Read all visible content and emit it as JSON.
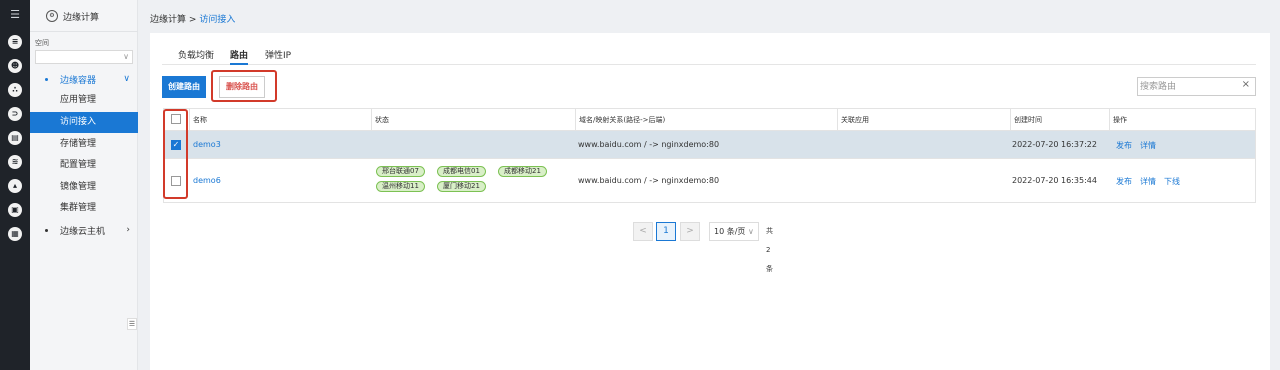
{
  "app": {
    "name": "边缘计算"
  },
  "rail_icons": [
    "menu-icon",
    "storage-icon",
    "robot-icon",
    "network-icon",
    "edge-icon",
    "database-icon",
    "layers-icon",
    "cloud-icon",
    "box-icon",
    "device-icon"
  ],
  "sidebar": {
    "space_label": "空间",
    "space_value": "",
    "groups": [
      {
        "label": "边缘容器",
        "expanded": true,
        "items": [
          "应用管理",
          "访问接入",
          "存储管理",
          "配置管理",
          "镜像管理",
          "集群管理"
        ]
      },
      {
        "label": "边缘云主机",
        "expanded": false
      }
    ],
    "active_item": "访问接入"
  },
  "breadcrumb": {
    "root": "边缘计算",
    "sep": ">",
    "current": "访问接入"
  },
  "tabs": [
    "负载均衡",
    "路由",
    "弹性IP"
  ],
  "active_tab": "路由",
  "toolbar": {
    "create_label": "创建路由",
    "delete_label": "删除路由"
  },
  "search": {
    "placeholder": "搜索路由",
    "clear": "×"
  },
  "table": {
    "headers": [
      "名称",
      "状态",
      "域名/映射关系(路径->后端)",
      "关联应用",
      "创建时间",
      "操作"
    ],
    "rows": [
      {
        "checked": true,
        "name": "demo3",
        "tags": [],
        "mapping": "www.baidu.com   / -> nginxdemo:80",
        "app": "",
        "created": "2022-07-20 16:37:22",
        "actions": [
          "发布",
          "详情"
        ]
      },
      {
        "checked": false,
        "name": "demo6",
        "tags": [
          "邢台联通07",
          "成都电信01",
          "成都移动21",
          "温州移动11",
          "厦门移动21"
        ],
        "mapping": "www.baidu.com   / -> nginxdemo:80",
        "app": "",
        "created": "2022-07-20 16:35:44",
        "actions": [
          "发布",
          "详情",
          "下线"
        ]
      }
    ]
  },
  "pagination": {
    "prev": "<",
    "page": "1",
    "next": ">",
    "page_size": "10 条/页",
    "total": "共2条"
  },
  "colors": {
    "accent": "#1a78d4",
    "highlight": "#d23a2a",
    "tag_bg": "#d9efc8",
    "selected_row": "#d8e2ea"
  }
}
